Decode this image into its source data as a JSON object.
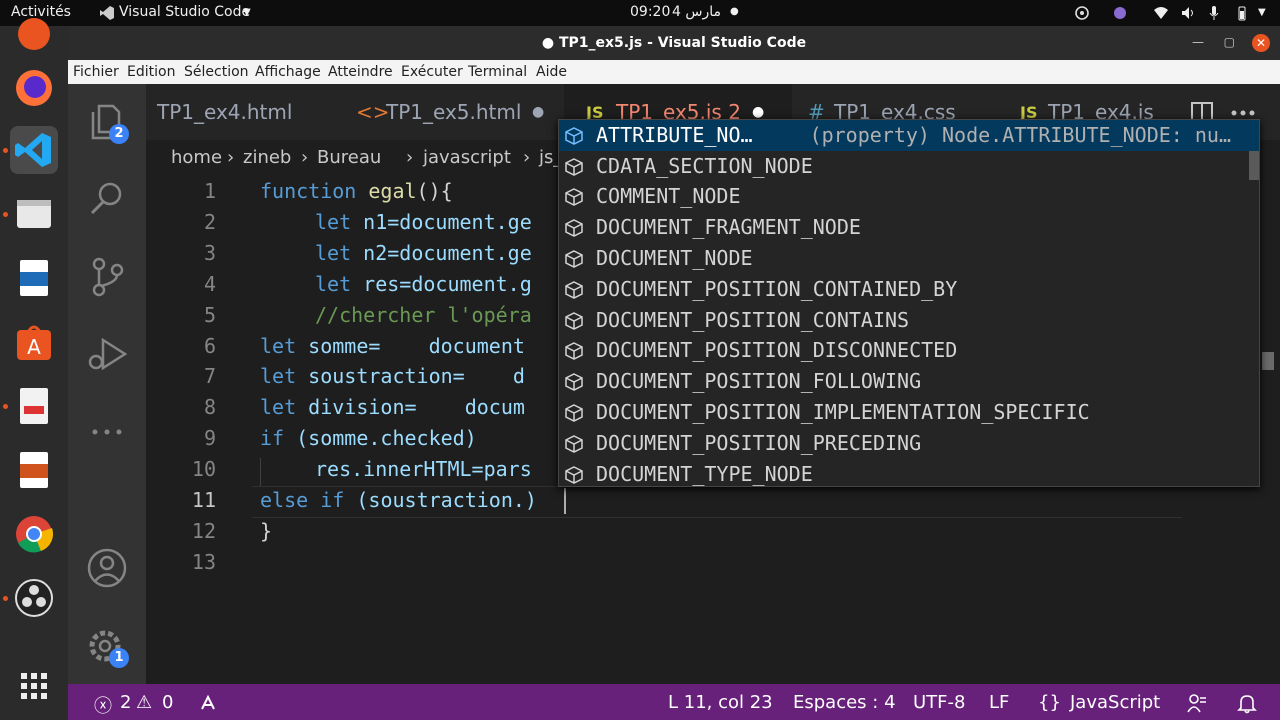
{
  "topbar": {
    "activities": "Activités",
    "app_name": "Visual Studio Code",
    "clock": "09:20",
    "date": "4 مارس"
  },
  "window": {
    "title": "● TP1_ex5.js - Visual Studio Code"
  },
  "menu": [
    "Fichier",
    "Edition",
    "Sélection",
    "Affichage",
    "Atteindre",
    "Exécuter",
    "Terminal",
    "Aide"
  ],
  "activity": {
    "explorer_badge": "2",
    "settings_badge": "1"
  },
  "tabs": [
    {
      "icon": "",
      "label": "TP1_ex4.html",
      "dirty": false
    },
    {
      "icon": "<>",
      "label": "TP1_ex5.html",
      "dirty": true
    },
    {
      "icon": "JS",
      "label": "TP1_ex5.js 2",
      "dirty": true,
      "active": true
    },
    {
      "icon": "#",
      "label": "TP1_ex4.css",
      "dirty": false
    },
    {
      "icon": "JS",
      "label": "TP1_ex4.js",
      "dirty": false
    }
  ],
  "breadcrumb": [
    "home",
    "zineb",
    "Bureau",
    "javascript",
    "js_"
  ],
  "editor": {
    "line_numbers": [
      "1",
      "2",
      "3",
      "4",
      "5",
      "6",
      "7",
      "8",
      "9",
      "10",
      "11",
      "12",
      "13"
    ],
    "lines": {
      "l1_kw": "function",
      "l1_fn": "egal",
      "l1_rest": "(){",
      "l2_kw": "let",
      "l2_rest": "n1=document.ge",
      "l3_kw": "let",
      "l3_rest": "n2=document.ge",
      "l4_kw": "let",
      "l4_rest": "res=document.g",
      "l5": "//chercher l'opéra",
      "l6_kw": "let",
      "l6_rest": "somme=    document",
      "l7_kw": "let",
      "l7_rest": "soustraction=    d",
      "l8_kw": "let",
      "l8_rest": "division=    docum",
      "l9_kw": "if",
      "l9_rest": "(somme.checked)",
      "l10": "res.innerHTML=pars",
      "l11_kw1": "else",
      "l11_kw2": "if",
      "l11_rest": "(soustraction.)",
      "l12": "}"
    }
  },
  "suggest": {
    "items": [
      "ATTRIBUTE_NO…",
      "CDATA_SECTION_NODE",
      "COMMENT_NODE",
      "DOCUMENT_FRAGMENT_NODE",
      "DOCUMENT_NODE",
      "DOCUMENT_POSITION_CONTAINED_BY",
      "DOCUMENT_POSITION_CONTAINS",
      "DOCUMENT_POSITION_DISCONNECTED",
      "DOCUMENT_POSITION_FOLLOWING",
      "DOCUMENT_POSITION_IMPLEMENTATION_SPECIFIC",
      "DOCUMENT_POSITION_PRECEDING",
      "DOCUMENT_TYPE_NODE"
    ],
    "selected_detail": "(property) Node.ATTRIBUTE_NODE: nu…"
  },
  "status": {
    "errors": "2",
    "warnings": "0",
    "position": "L 11, col 23",
    "spaces": "Espaces : 4",
    "encoding": "UTF-8",
    "eol": "LF",
    "language_icon": "{}",
    "language": "JavaScript"
  },
  "colors": {
    "statusbar": "#68217a",
    "keyword": "#569cd6",
    "function": "#dcdcaa",
    "variable": "#9cdcfe",
    "comment": "#6a9955",
    "ubuntu_orange": "#e95420"
  }
}
